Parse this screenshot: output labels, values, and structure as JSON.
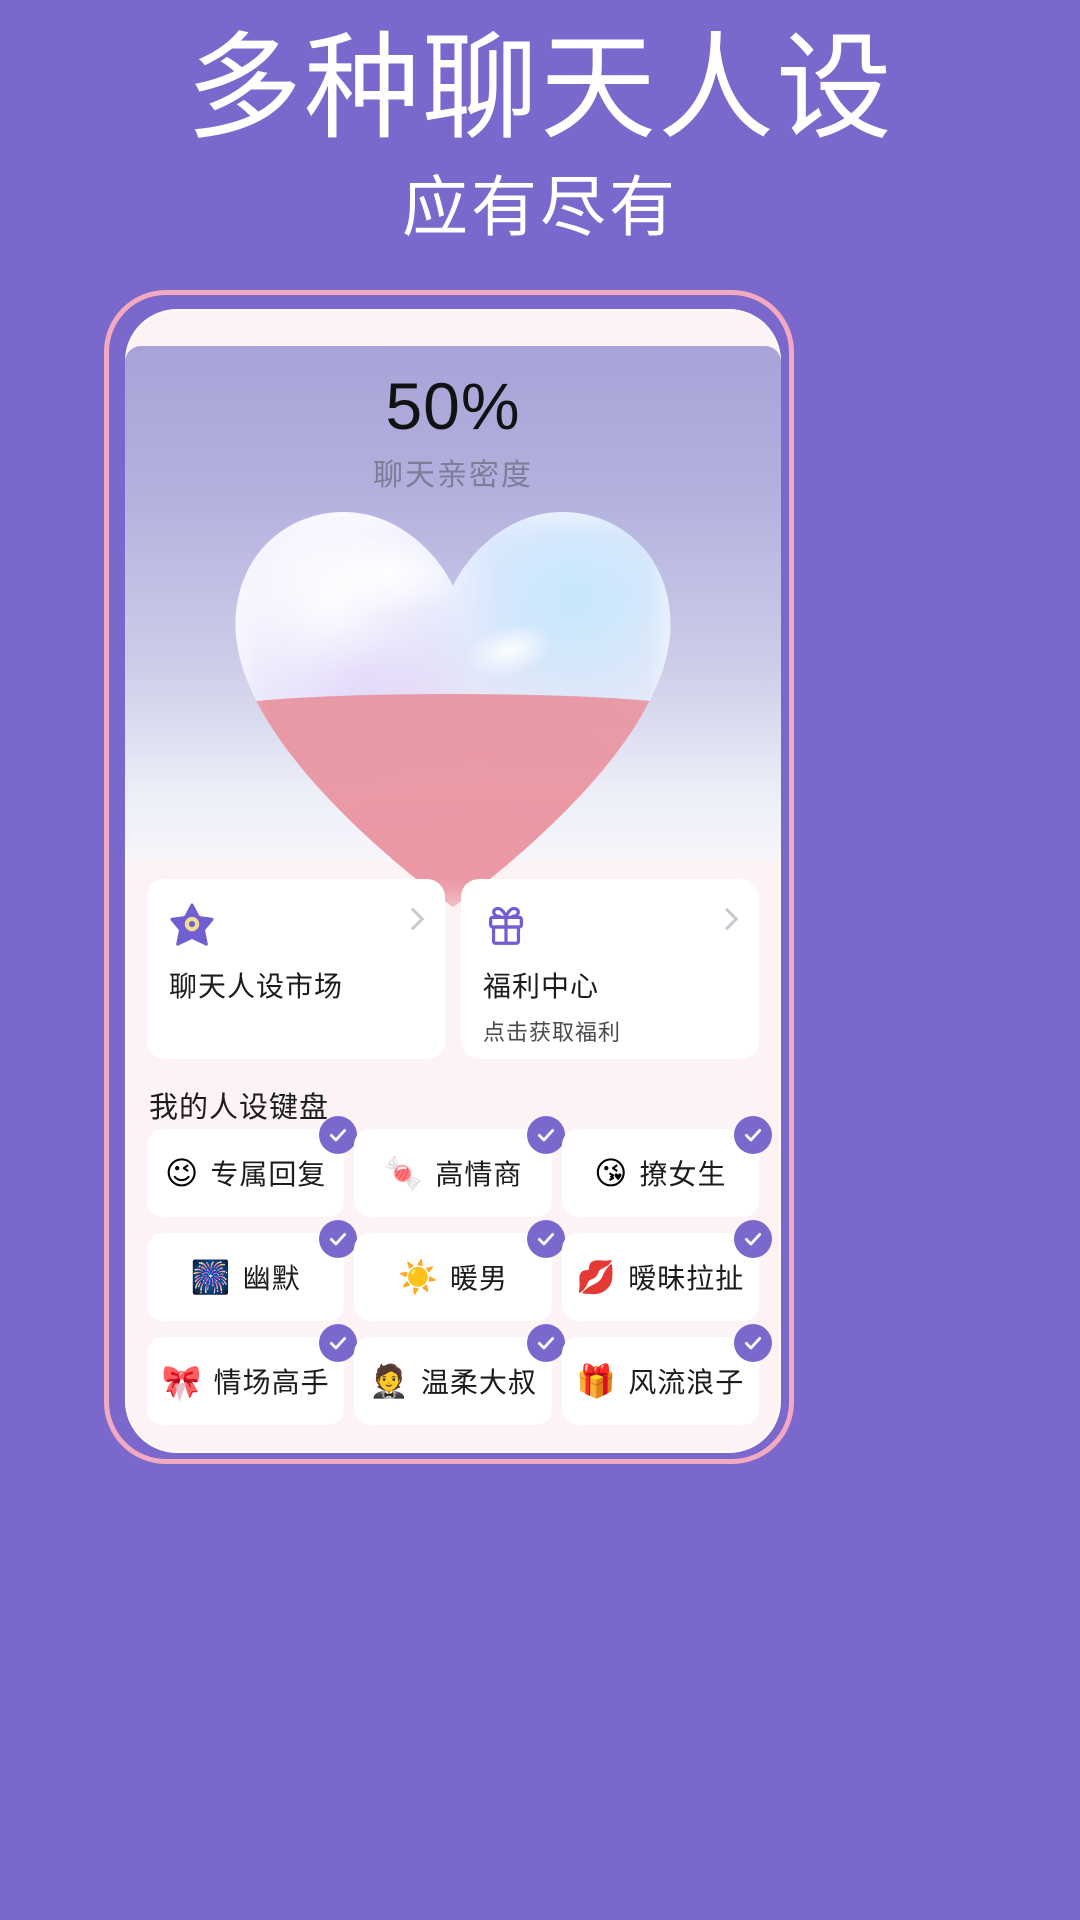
{
  "promo": {
    "title": "多种聊天人设",
    "subtitle": "应有尽有"
  },
  "colors": {
    "background": "#7a68cc",
    "accent": "#7a68cc",
    "phone_border": "#f3a9c0",
    "phone_bg": "#fdf3f4",
    "heart_fill": "#e9939f",
    "card_bg": "#ffffff"
  },
  "phone": {
    "hero": {
      "percent": "50%",
      "percent_label": "聊天亲密度",
      "fill_ratio": 50
    },
    "entries": [
      {
        "icon": "star-icon",
        "title": "聊天人设市场",
        "subtitle": "",
        "has_chevron": true
      },
      {
        "icon": "gift-icon",
        "title": "福利中心",
        "subtitle": "点击获取福利",
        "has_chevron": true
      }
    ],
    "keyboard": {
      "section_title": "我的人设键盘",
      "chips": [
        {
          "emoji": "😉",
          "label": "专属回复",
          "checked": true
        },
        {
          "emoji": "🍬",
          "label": "高情商",
          "checked": true
        },
        {
          "emoji": "😘",
          "label": "撩女生",
          "checked": true
        },
        {
          "emoji": "🎆",
          "label": "幽默",
          "checked": true
        },
        {
          "emoji": "☀️",
          "label": "暖男",
          "checked": true
        },
        {
          "emoji": "💋",
          "label": "暧昧拉扯",
          "checked": true
        },
        {
          "emoji": "🎀",
          "label": "情场高手",
          "checked": true
        },
        {
          "emoji": "🤵",
          "label": "温柔大叔",
          "checked": true
        },
        {
          "emoji": "🎁",
          "label": "风流浪子",
          "checked": true
        }
      ]
    }
  }
}
